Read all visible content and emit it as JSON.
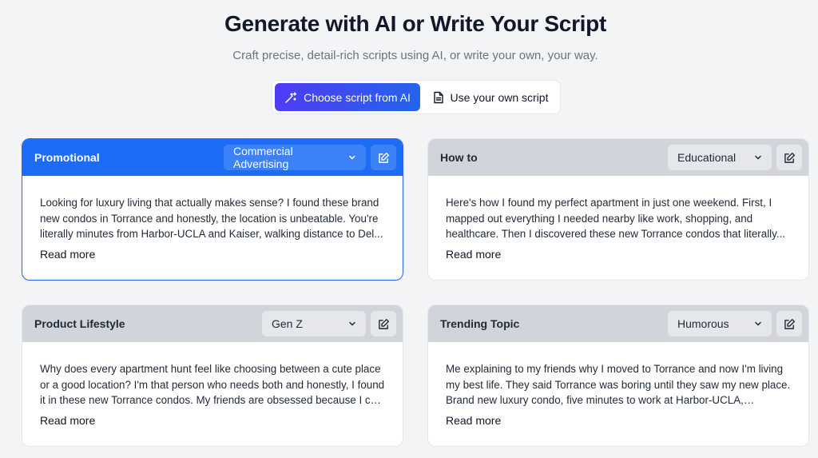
{
  "header": {
    "title": "Generate with AI or Write Your Script",
    "subtitle": "Craft precise, detail-rich scripts using AI, or write your own, your way."
  },
  "mode_toggle": {
    "ai_label": "Choose script from AI",
    "own_label": "Use your own script",
    "selected": "ai"
  },
  "cards": [
    {
      "title": "Promotional",
      "select_value": "Commercial Advertising",
      "text": "Looking for luxury living that actually makes sense? I found these brand new condos in Torrance and honestly, the location is unbeatable. You're literally minutes from Harbor-UCLA and Kaiser, walking distance to Del...",
      "read_more": "Read more",
      "selected": true
    },
    {
      "title": "How to",
      "select_value": "Educational",
      "text": "Here's how I found my perfect apartment in just one weekend. First, I mapped out everything I needed nearby like work, shopping, and healthcare. Then I discovered these new Torrance condos that literally...",
      "read_more": "Read more",
      "selected": false
    },
    {
      "title": "Product Lifestyle",
      "select_value": "Gen Z",
      "text": "Why does every apartment hunt feel like choosing between a cute place or a good location? I'm that person who needs both and honestly, I found it in these new Torrance condos. My friends are obsessed because I can wal...",
      "read_more": "Read more",
      "selected": false
    },
    {
      "title": "Trending Topic",
      "select_value": "Humorous",
      "text": "Me explaining to my friends why I moved to Torrance and now I'm living my best life. They said Torrance was boring until they saw my new place. Brand new luxury condo, five minutes to work at Harbor-UCLA, walking...",
      "read_more": "Read more",
      "selected": false
    }
  ],
  "colors": {
    "accent": "#1d6cf5",
    "gradient_start": "#4f3cf5",
    "gradient_end": "#2563eb",
    "background": "#f3f4f6"
  },
  "icons": {
    "ai_button": "magic-wand-icon",
    "own_button": "document-icon",
    "select": "chevron-down-icon",
    "edit": "edit-icon"
  }
}
